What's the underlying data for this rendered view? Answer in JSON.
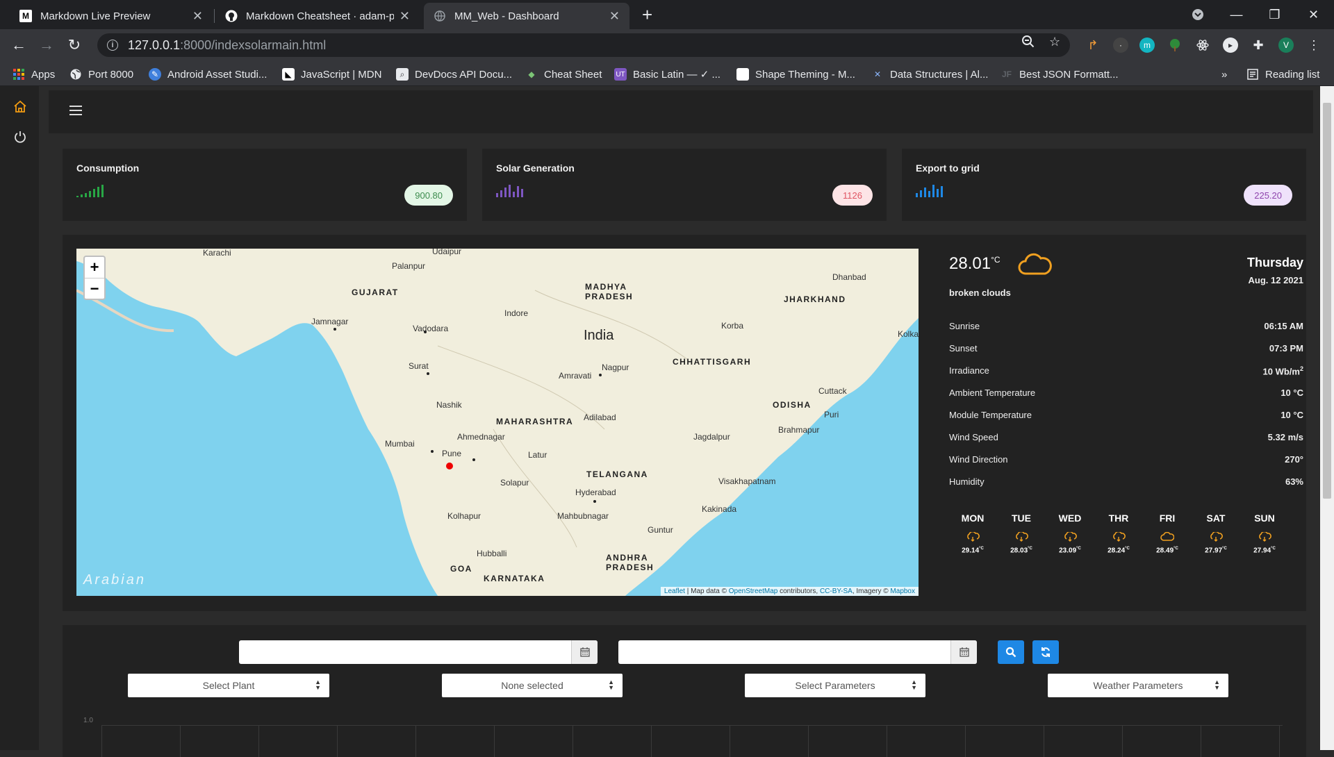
{
  "browser": {
    "tabs": [
      {
        "title": "Markdown Live Preview",
        "icon": "markdown-icon",
        "active": false
      },
      {
        "title": "Markdown Cheatsheet · adam-p/",
        "icon": "github-icon",
        "active": false
      },
      {
        "title": "MM_Web - Dashboard",
        "icon": "globe-icon",
        "active": true
      }
    ],
    "url_host": "127.0.0.1",
    "url_path": ":8000/indexsolarmain.html",
    "bookmarks": [
      {
        "label": "Apps",
        "icon": "apps-grid-icon"
      },
      {
        "label": "Port 8000",
        "icon": "globe-icon"
      },
      {
        "label": "Android Asset Studi...",
        "icon": "android-asset-icon"
      },
      {
        "label": "JavaScript | MDN",
        "icon": "mdn-icon"
      },
      {
        "label": "DevDocs API Docu...",
        "icon": "devdocs-icon"
      },
      {
        "label": "Cheat Sheet",
        "icon": "cheat-sheet-icon"
      },
      {
        "label": "Basic Latin — ✓ ...",
        "icon": "ut-icon"
      },
      {
        "label": "Shape Theming - M...",
        "icon": "material-icon"
      },
      {
        "label": "Data Structures | Al...",
        "icon": "data-structures-icon"
      },
      {
        "label": "Best JSON Formatt...",
        "icon": "jf-icon"
      }
    ],
    "overflow_label": "»",
    "reading_list": "Reading list",
    "profile_initial": "V",
    "extension_initial": "m"
  },
  "stats": [
    {
      "title": "Consumption",
      "value": "900.80",
      "color": "#28a745",
      "pill_bg": "#e3f6e6",
      "pill_color": "#3c8c4e"
    },
    {
      "title": "Solar Generation",
      "value": "1126",
      "color": "#7e57c2",
      "pill_bg": "#fde4e6",
      "pill_color": "#e05563"
    },
    {
      "title": "Export to grid",
      "value": "225.20",
      "color": "#1e88e5",
      "pill_bg": "#efe2fb",
      "pill_color": "#8e44ad"
    }
  ],
  "map": {
    "zoom_in": "+",
    "zoom_out": "−",
    "labels": {
      "karachi": "Karachi",
      "udaipur": "Udaipur",
      "palanpur": "Palanpur",
      "gujarat": "GUJARAT",
      "madhya": "MADHYA",
      "pradesh": "PRADESH",
      "dhanbad": "Dhanbad",
      "jharkhand": "JHARKHAND",
      "jamnagar": "Jamnagar",
      "vadodara": "Vadodara",
      "indore": "Indore",
      "india": "India",
      "korba": "Korba",
      "kolkata": "Kolka",
      "surat": "Surat",
      "amravati": "Amravati",
      "nagpur": "Nagpur",
      "chhattisgarh": "CHHATTISGARH",
      "cuttack": "Cuttack",
      "odisha": "ODISHA",
      "nashik": "Nashik",
      "maharashtra": "MAHARASHTRA",
      "adilabad": "Adilabad",
      "puri": "Puri",
      "brahmapur": "Brahmapur",
      "mumbai": "Mumbai",
      "ahmednagar": "Ahmednagar",
      "jagdalpur": "Jagdalpur",
      "pune": "Pune",
      "latur": "Latur",
      "telangana": "TELANGANA",
      "solapur": "Solapur",
      "visakhapatnam": "Visakhapatnam",
      "hyderabad": "Hyderabad",
      "kolhapur": "Kolhapur",
      "mahbubnagar": "Mahbubnagar",
      "kakinada": "Kakinada",
      "guntur": "Guntur",
      "andhra": "ANDHRA",
      "andhra2": "PRADESH",
      "hubballi": "Hubballi",
      "goa": "GOA",
      "karnataka": "KARNATAKA",
      "arabian": "Arabian"
    },
    "attribution": {
      "leaflet": "Leaflet",
      "sep1": " | Map data © ",
      "osm": "OpenStreetMap",
      "sep2": " contributors, ",
      "ccbysa": "CC-BY-SA",
      "sep3": ", Imagery © ",
      "mapbox": "Mapbox"
    }
  },
  "weather": {
    "temp": "28.01",
    "unit": "°C",
    "condition": "broken clouds",
    "day": "Thursday",
    "date": "Aug. 12 2021",
    "rows": [
      {
        "label": "Sunrise",
        "value": "06:15 AM"
      },
      {
        "label": "Sunset",
        "value": "07:3 PM"
      },
      {
        "label": "Irradiance",
        "value": "10 Wb/m",
        "sup": "2"
      },
      {
        "label": "Ambient Temperature",
        "value": "10 °C"
      },
      {
        "label": "Module Temperature",
        "value": "10 °C"
      },
      {
        "label": "Wind Speed",
        "value": "5.32 m/s"
      },
      {
        "label": "Wind Direction",
        "value": "270°"
      },
      {
        "label": "Humidity",
        "value": "63%"
      }
    ],
    "forecast": [
      {
        "day": "MON",
        "temp": "29.14",
        "icon": "cloud-rain-icon"
      },
      {
        "day": "TUE",
        "temp": "28.03",
        "icon": "cloud-rain-icon"
      },
      {
        "day": "WED",
        "temp": "23.09",
        "icon": "cloud-rain-icon"
      },
      {
        "day": "THR",
        "temp": "28.24",
        "icon": "cloud-rain-icon"
      },
      {
        "day": "FRI",
        "temp": "28.49",
        "icon": "cloud-icon"
      },
      {
        "day": "SAT",
        "temp": "27.97",
        "icon": "cloud-rain-icon"
      },
      {
        "day": "SUN",
        "temp": "27.94",
        "icon": "cloud-rain-icon"
      }
    ],
    "accent": "#f0a020"
  },
  "filters": {
    "start_date": "",
    "end_date": "",
    "select_plant": "Select Plant",
    "none_selected": "None selected",
    "select_parameters": "Select Parameters",
    "weather_parameters": "Weather Parameters"
  },
  "chart": {
    "y_tick": "1.0"
  }
}
